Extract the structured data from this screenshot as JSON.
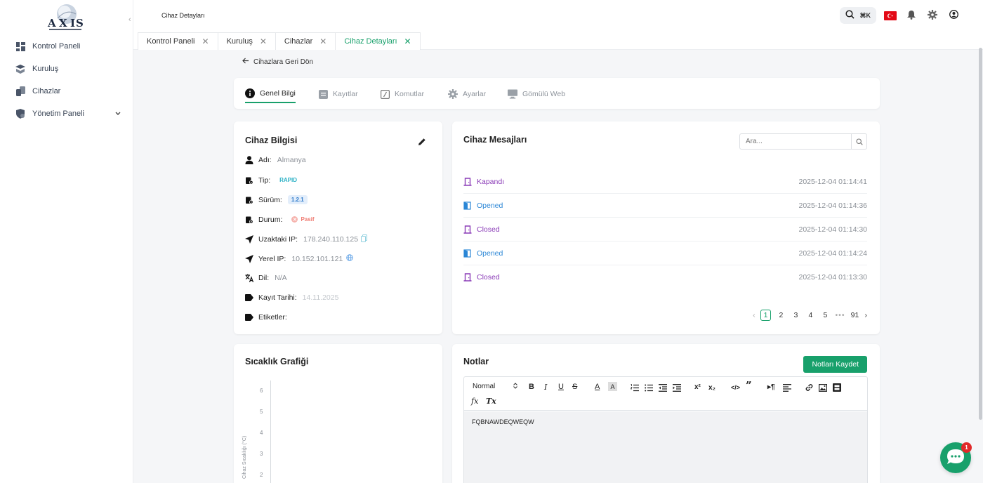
{
  "brand": {
    "logo_text": "AXIS"
  },
  "topbar": {
    "page_label": "Cihaz Detayları",
    "kbd": "⌘K"
  },
  "sidebar": {
    "items": [
      {
        "label": "Kontrol Paneli"
      },
      {
        "label": "Kuruluş"
      },
      {
        "label": "Cihazlar"
      },
      {
        "label": "Yönetim Paneli"
      }
    ]
  },
  "tabs": [
    {
      "label": "Kontrol Paneli"
    },
    {
      "label": "Kuruluş"
    },
    {
      "label": "Cihazlar"
    },
    {
      "label": "Cihaz Detayları"
    }
  ],
  "back_label": "Cihazlara Geri Dön",
  "detail_tabs": [
    {
      "label": "Genel Bilgi"
    },
    {
      "label": "Kayıtlar"
    },
    {
      "label": "Komutlar"
    },
    {
      "label": "Ayarlar"
    },
    {
      "label": "Gömülü Web"
    }
  ],
  "device_info": {
    "title": "Cihaz Bilgisi",
    "name_label": "Adı:",
    "name_value": "Almanya",
    "type_label": "Tip:",
    "type_value": "RAPID",
    "version_label": "Sürüm:",
    "version_value": "1.2.1",
    "status_label": "Durum:",
    "status_value": "Pasif",
    "remote_ip_label": "Uzaktaki IP:",
    "remote_ip_value": "178.240.110.125",
    "local_ip_label": "Yerel IP:",
    "local_ip_value": "10.152.101.121",
    "lang_label": "Dil:",
    "lang_value": "N/A",
    "reg_label": "Kayıt Tarihi:",
    "reg_value": "14.11.2025",
    "tags_label": "Etiketler:"
  },
  "messages": {
    "title": "Cihaz Mesajları",
    "search_placeholder": "Ara...",
    "rows": [
      {
        "text": "Kapandı",
        "time": "2025-12-04 01:14:41",
        "state": "closed"
      },
      {
        "text": "Opened",
        "time": "2025-12-04 01:14:36",
        "state": "opened"
      },
      {
        "text": "Closed",
        "time": "2025-12-04 01:14:30",
        "state": "closed"
      },
      {
        "text": "Opened",
        "time": "2025-12-04 01:14:24",
        "state": "opened"
      },
      {
        "text": "Closed",
        "time": "2025-12-04 01:13:30",
        "state": "closed"
      }
    ],
    "pagination": {
      "current": "1",
      "pages": [
        "1",
        "2",
        "3",
        "4",
        "5"
      ],
      "ellipsis": "•••",
      "last": "91"
    }
  },
  "temperature": {
    "title": "Sıcaklık Grafiği",
    "ylabel": "Cihaz Sıcaklığı (°C)",
    "yticks": [
      "6",
      "5",
      "4",
      "3",
      "2"
    ]
  },
  "notes": {
    "title": "Notlar",
    "save_label": "Notları Kaydet",
    "format_value": "Normal",
    "content": "FQBNAWDEQWEQW"
  },
  "chat": {
    "badge": "1"
  },
  "colors": {
    "accent": "#18a06b",
    "closed": "#8a3bb7",
    "opened": "#2a86d6",
    "flag": "#e30a17"
  }
}
